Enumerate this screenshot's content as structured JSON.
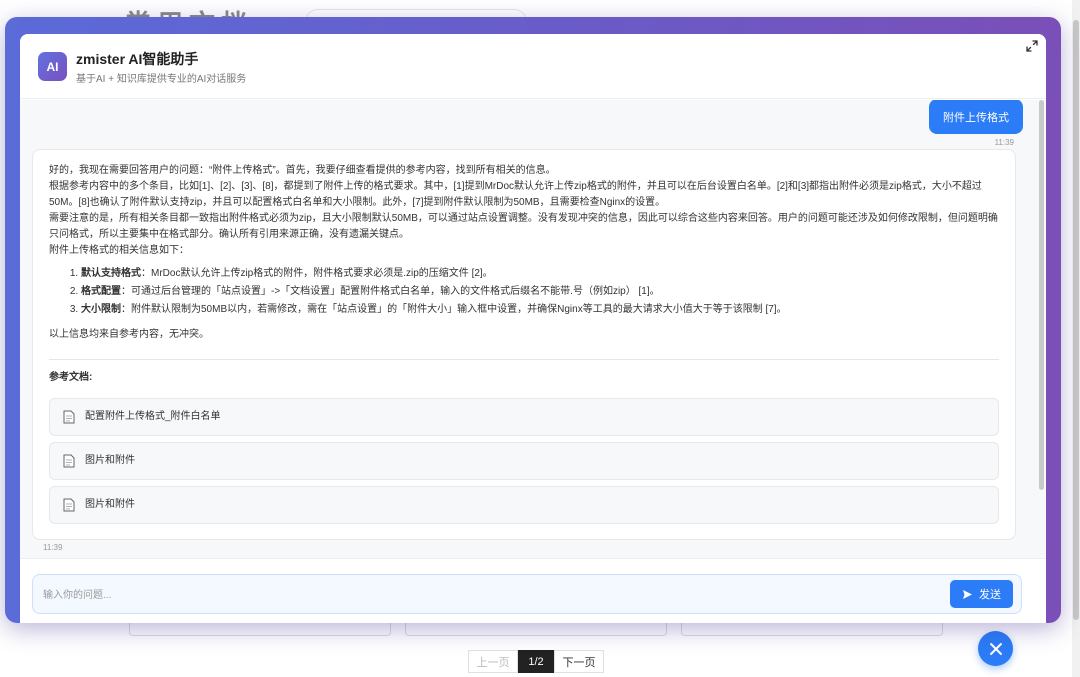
{
  "background": {
    "title": "常用文档",
    "pagination": {
      "prev": "上一页",
      "current": "1/2",
      "next": "下一页"
    }
  },
  "modal": {
    "avatar_text": "AI",
    "title": "zmister AI智能助手",
    "subtitle": "基于AI + 知识库提供专业的AI对话服务"
  },
  "chat": {
    "user_message": {
      "text": "附件上传格式",
      "time": "11:39"
    },
    "ai_message": {
      "time": "11:39",
      "thinking": [
        "好的，我现在需要回答用户的问题：“附件上传格式”。首先，我要仔细查看提供的参考内容，找到所有相关的信息。",
        "根据参考内容中的多个条目，比如[1]、[2]、[3]、[8]，都提到了附件上传的格式要求。其中，[1]提到MrDoc默认允许上传zip格式的附件，并且可以在后台设置白名单。[2]和[3]都指出附件必须是zip格式，大小不超过50M。[8]也确认了附件默认支持zip，并且可以配置格式白名单和大小限制。此外，[7]提到附件默认限制为50MB，且需要检查Nginx的设置。",
        "需要注意的是，所有相关条目都一致指出附件格式必须为zip，且大小限制默认50MB，可以通过站点设置调整。没有发现冲突的信息，因此可以综合这些内容来回答。用户的问题可能还涉及如何修改限制，但问题明确只问格式，所以主要集中在格式部分。确认所有引用来源正确，没有遗漏关键点。",
        "附件上传格式的相关信息如下："
      ],
      "list": [
        {
          "label": "默认支持格式",
          "text": "：MrDoc默认允许上传zip格式的附件，附件格式要求必须是.zip的压缩文件 [2]。"
        },
        {
          "label": "格式配置",
          "text": "：可通过后台管理的「站点设置」->「文档设置」配置附件格式白名单，输入的文件格式后缀名不能带.号（例如zip） [1]。"
        },
        {
          "label": "大小限制",
          "text": "：附件默认限制为50MB以内，若需修改，需在「站点设置」的「附件大小」输入框中设置，并确保Nginx等工具的最大请求大小值大于等于该限制 [7]。"
        }
      ],
      "conclusion": "以上信息均来自参考内容，无冲突。",
      "references_title": "参考文档:",
      "references": [
        "配置附件上传格式_附件白名单",
        "图片和附件",
        "图片和附件"
      ]
    }
  },
  "input": {
    "placeholder": "输入你的问题...",
    "value": "",
    "send_label": "发送"
  },
  "colors": {
    "accent": "#2b7cf6",
    "gradient_start": "#5b6bd8",
    "gradient_end": "#7a4fb8"
  }
}
